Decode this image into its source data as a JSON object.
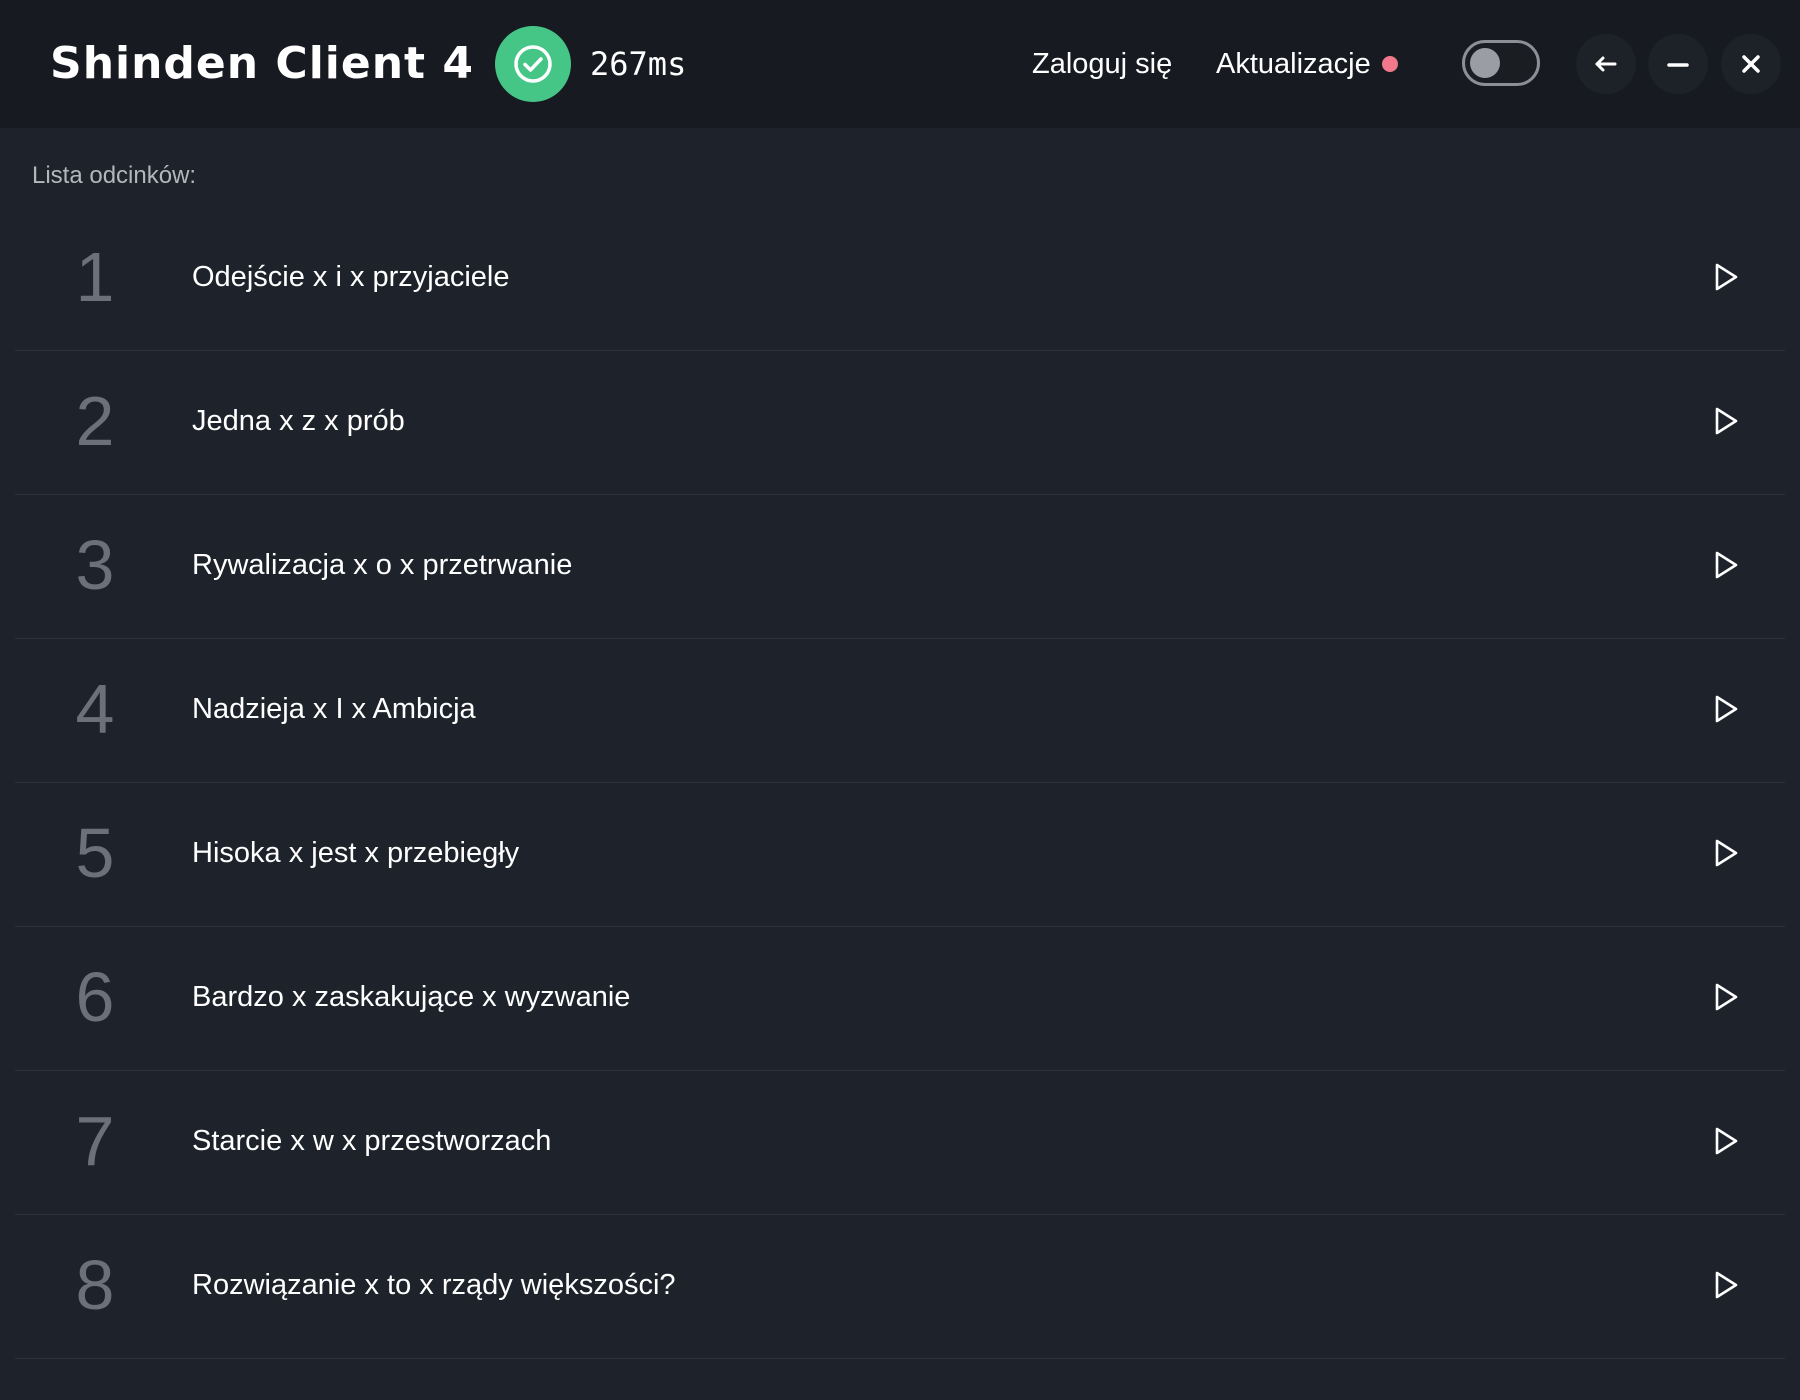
{
  "app": {
    "title": "Shinden Client 4"
  },
  "header": {
    "connection": {
      "status_icon": "check-circle-icon",
      "status_color": "#45c586",
      "ping": "267ms"
    },
    "nav": {
      "login_label": "Zaloguj się",
      "updates_label": "Aktualizacje",
      "updates_indicator_color": "#f0788a"
    },
    "theme_toggle": {
      "state": "off"
    },
    "window_controls": {
      "back_icon": "arrow-left-icon",
      "minimize_icon": "minus-icon",
      "close_icon": "close-icon"
    }
  },
  "episodes": {
    "heading": "Lista odcinków:",
    "play_icon": "play-icon",
    "items": [
      {
        "number": "1",
        "title": "Odejście x i x przyjaciele"
      },
      {
        "number": "2",
        "title": "Jedna x z x prób"
      },
      {
        "number": "3",
        "title": "Rywalizacja x o x przetrwanie"
      },
      {
        "number": "4",
        "title": "Nadzieja x I x Ambicja"
      },
      {
        "number": "5",
        "title": "Hisoka x jest x przebiegły"
      },
      {
        "number": "6",
        "title": "Bardzo x zaskakujące x wyzwanie"
      },
      {
        "number": "7",
        "title": "Starcie x w x przestworzach"
      },
      {
        "number": "8",
        "title": "Rozwiązanie x to x rządy większości?"
      }
    ]
  }
}
